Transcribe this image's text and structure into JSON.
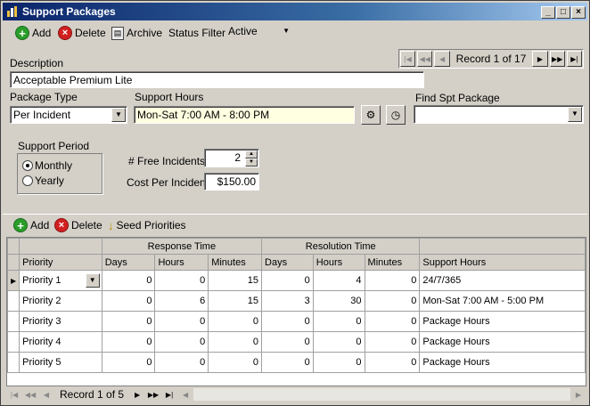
{
  "window": {
    "title": "Support Packages",
    "icon": "app-icon"
  },
  "toolbar": {
    "add_label": "Add",
    "delete_label": "Delete",
    "archive_label": "Archive",
    "status_filter_label": "Status Filter",
    "status_filter_value": "Active"
  },
  "nav": {
    "record_text": "Record 1 of 17"
  },
  "form": {
    "description_label": "Description",
    "description_value": "Acceptable Premium Lite",
    "package_type_label": "Package Type",
    "package_type_value": "Per Incident",
    "support_hours_label": "Support Hours",
    "support_hours_value": "Mon-Sat 7:00 AM - 8:00 PM",
    "find_label": "Find Spt Package",
    "find_value": "",
    "support_period_label": "Support Period",
    "period_monthly": "Monthly",
    "period_yearly": "Yearly",
    "period_selected": "Monthly",
    "free_incidents_label": "# Free Incidents",
    "free_incidents_value": "2",
    "cost_label": "Cost Per Incident",
    "cost_value": "$150.00"
  },
  "detail_toolbar": {
    "add_label": "Add",
    "delete_label": "Delete",
    "seed_label": "Seed Priorities"
  },
  "grid": {
    "group_headers": {
      "response": "Response Time",
      "resolution": "Resolution Time"
    },
    "columns": [
      "Priority",
      "Days",
      "Hours",
      "Minutes",
      "Days",
      "Hours",
      "Minutes",
      "Support Hours"
    ],
    "rows": [
      [
        "Priority 1",
        "0",
        "0",
        "15",
        "0",
        "4",
        "0",
        "24/7/365"
      ],
      [
        "Priority 2",
        "0",
        "6",
        "15",
        "3",
        "30",
        "0",
        "Mon-Sat 7:00 AM - 5:00 PM"
      ],
      [
        "Priority 3",
        "0",
        "0",
        "0",
        "0",
        "0",
        "0",
        "Package Hours"
      ],
      [
        "Priority 4",
        "0",
        "0",
        "0",
        "0",
        "0",
        "0",
        "Package Hours"
      ],
      [
        "Priority 5",
        "0",
        "0",
        "0",
        "0",
        "0",
        "0",
        "Package Hours"
      ]
    ],
    "nav_text": "Record 1 of 5"
  }
}
